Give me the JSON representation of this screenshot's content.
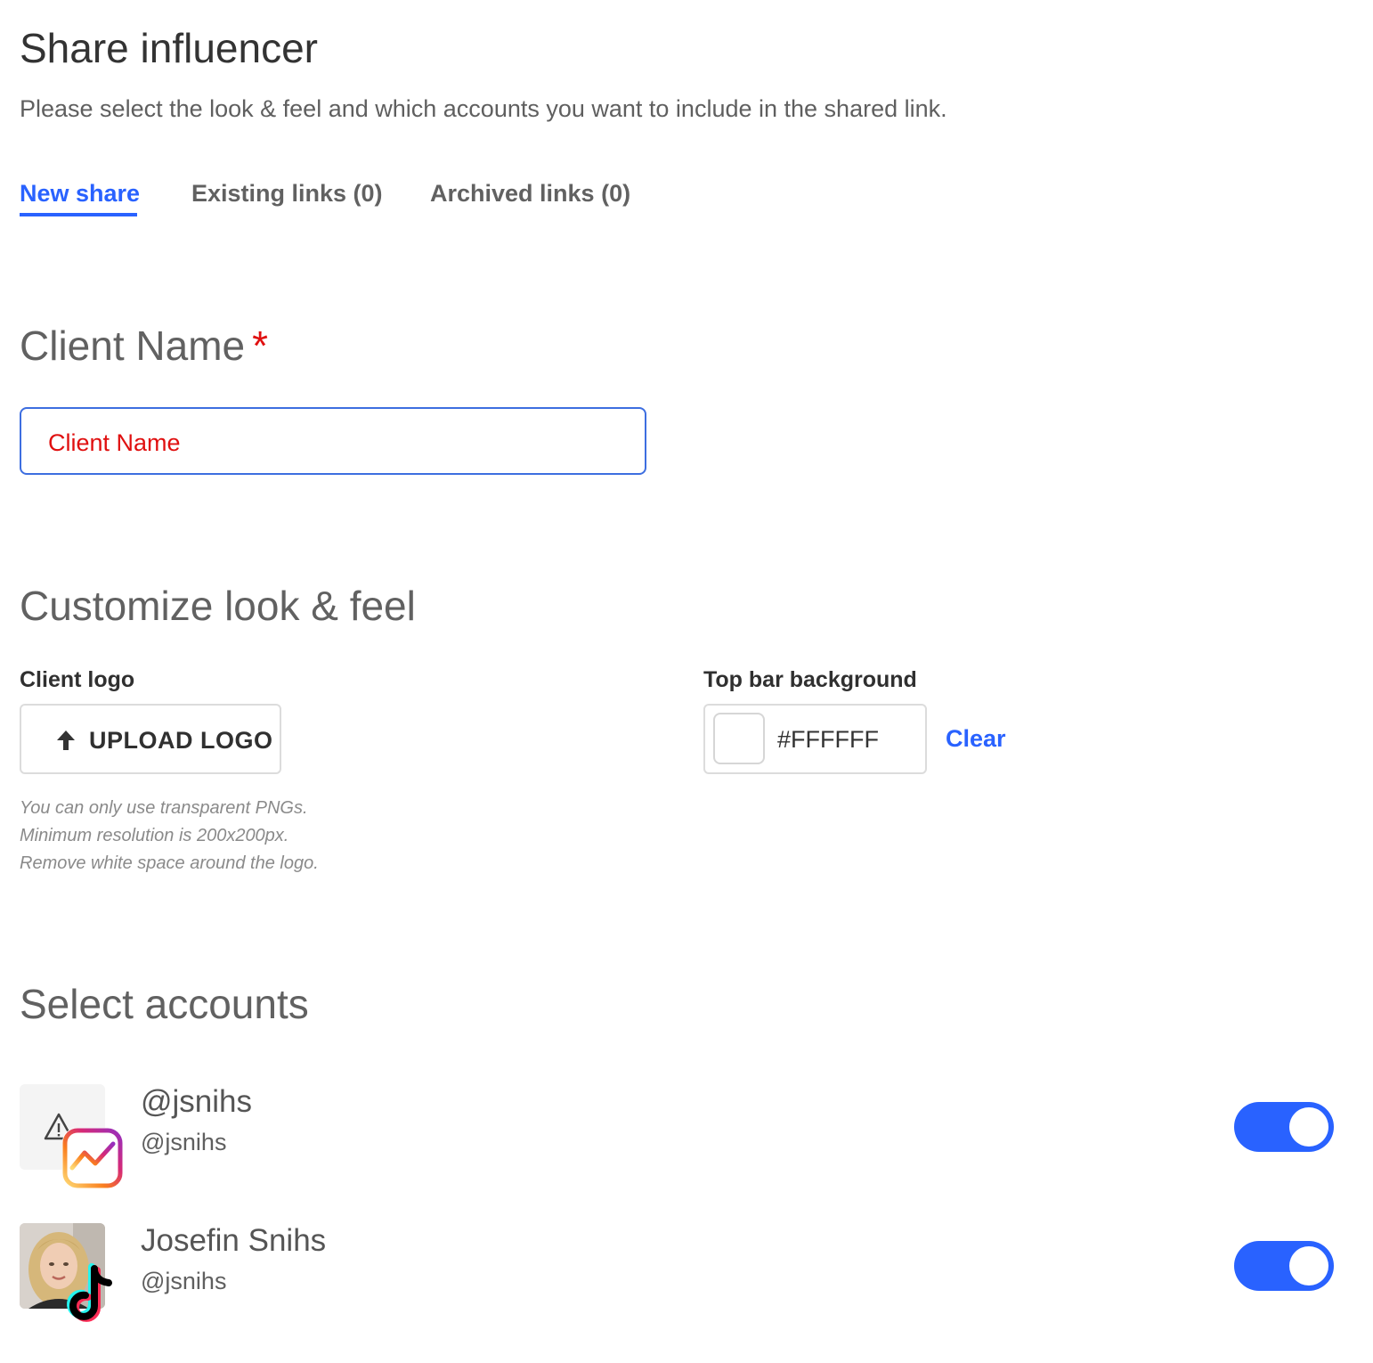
{
  "header": {
    "title": "Share influencer",
    "subtitle": "Please select the look & feel and which accounts you want to include in the shared link."
  },
  "tabs": [
    {
      "label": "New share",
      "active": true
    },
    {
      "label": "Existing links (0)",
      "active": false
    },
    {
      "label": "Archived links (0)",
      "active": false
    }
  ],
  "client_name": {
    "heading": "Client Name",
    "required_mark": "*",
    "placeholder": "Client Name",
    "value": ""
  },
  "customize": {
    "heading": "Customize look & feel",
    "logo": {
      "label": "Client logo",
      "button_label": "UPLOAD LOGO",
      "button_icon": "arrow-up-icon",
      "hints": [
        "You can only use transparent PNGs.",
        "Minimum resolution is 200x200px.",
        "Remove white space around the logo."
      ]
    },
    "topbar": {
      "label": "Top bar background",
      "value": "#FFFFFF",
      "clear_label": "Clear"
    }
  },
  "accounts": {
    "heading": "Select accounts",
    "items": [
      {
        "name": "@jsnihs",
        "handle": "@jsnihs",
        "platform": "instagram-icon",
        "avatar": "broken-image-icon",
        "enabled": true
      },
      {
        "name": "Josefin Snihs",
        "handle": "@jsnihs",
        "platform": "tiktok-icon",
        "avatar": "profile-photo",
        "enabled": true
      }
    ]
  },
  "colors": {
    "accent": "#2962ff",
    "required": "#e01010",
    "input_border": "#3d6ee0"
  }
}
